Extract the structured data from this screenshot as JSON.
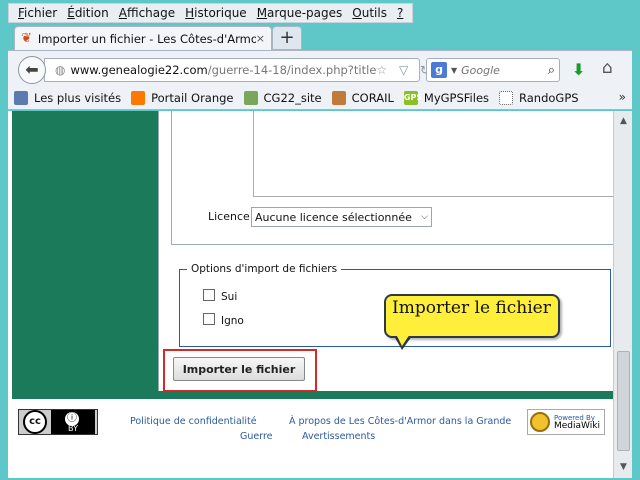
{
  "menu": {
    "items": [
      {
        "first": "F",
        "rest": "ichier"
      },
      {
        "first": "É",
        "rest": "dition"
      },
      {
        "first": "A",
        "rest": "ffichage"
      },
      {
        "first": "H",
        "rest": "istorique"
      },
      {
        "first": "M",
        "rest": "arque-pages"
      },
      {
        "first": "O",
        "rest": "utils"
      },
      {
        "first": "?",
        "rest": ""
      }
    ]
  },
  "tab": {
    "title": "Importer un fichier - Les Côtes-d'Armor ...",
    "close": "×",
    "new_tab": "+"
  },
  "url": {
    "host": "www.genealogie22.com",
    "path": "/guerre-14-18/index.php?title",
    "tools": "☆ ▽ ↻"
  },
  "search": {
    "engine": "g",
    "placeholder": "Google"
  },
  "bookmarks": [
    {
      "label": "Les plus visités",
      "icon": "visited-icon",
      "color": "#5b7bb0",
      "glyph": ""
    },
    {
      "label": "Portail Orange",
      "icon": "orange-icon",
      "color": "#ff7900",
      "glyph": ""
    },
    {
      "label": "CG22_site",
      "icon": "cg22-icon",
      "color": "#7aa65a",
      "glyph": ""
    },
    {
      "label": "CORAIL",
      "icon": "corail-icon",
      "color": "#c07a3a",
      "glyph": ""
    },
    {
      "label": "MyGPSFiles",
      "icon": "mygps-icon",
      "color": "#8cbf26",
      "glyph": "GPS"
    },
    {
      "label": "RandoGPS",
      "icon": "dotted-icon",
      "color": "#ffffff",
      "glyph": ""
    }
  ],
  "form": {
    "license_label": "Licence",
    "license_value": "Aucune licence sélectionnée",
    "options_legend": "Options d'import de fichiers",
    "option1_label": "Sui",
    "option2_label": "Igno",
    "submit_label": "Importer le fichier"
  },
  "tooltip": {
    "text": "Importer le fichier"
  },
  "footer": {
    "privacy": "Politique de confidentialité",
    "about_line1": "À propos de Les Côtes-d'Armor dans la Grande",
    "about_line2": "Guerre",
    "disclaimers": "Avertissements",
    "mw_powered": "Powered By",
    "mw_name": "MediaWiki",
    "cc": "cc",
    "by": "BY"
  }
}
